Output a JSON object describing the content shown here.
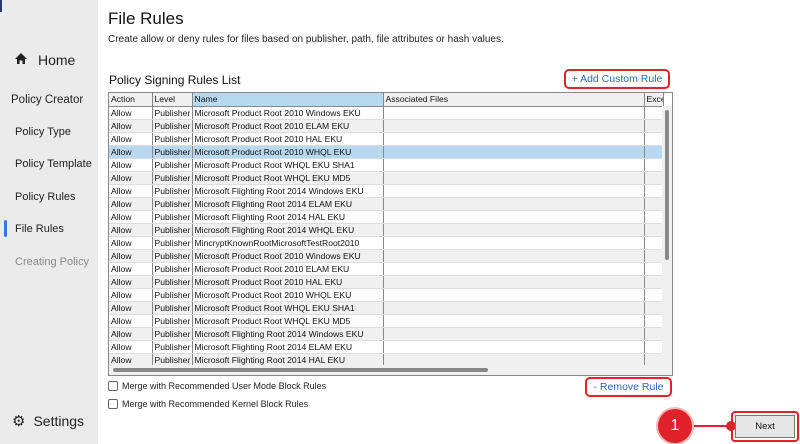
{
  "sidebar": {
    "home": "Home",
    "section": "Policy Creator",
    "items": [
      {
        "label": "Policy Type"
      },
      {
        "label": "Policy Template"
      },
      {
        "label": "Policy Rules"
      },
      {
        "label": "File Rules"
      },
      {
        "label": "Creating Policy"
      }
    ],
    "settings": "Settings"
  },
  "page": {
    "title": "File Rules",
    "description": "Create allow or deny rules for files based on publisher, path, file attributes or hash values.",
    "list_title": "Policy Signing Rules List",
    "add_button": "+ Add Custom Rule",
    "remove_button": "- Remove Rule",
    "next_button": "Next",
    "step_marker": "1"
  },
  "table": {
    "columns": [
      "Action",
      "Level",
      "Name",
      "Associated Files",
      "Exce"
    ],
    "rows": [
      [
        "Allow",
        "Publisher",
        "Microsoft Product Root 2010 Windows EKU"
      ],
      [
        "Allow",
        "Publisher",
        "Microsoft Product Root 2010 ELAM EKU"
      ],
      [
        "Allow",
        "Publisher",
        "Microsoft Product Root 2010 HAL EKU"
      ],
      [
        "Allow",
        "Publisher",
        "Microsoft Product Root 2010 WHQL EKU"
      ],
      [
        "Allow",
        "Publisher",
        "Microsoft Product Root WHQL EKU SHA1"
      ],
      [
        "Allow",
        "Publisher",
        "Microsoft Product Root WHQL EKU MD5"
      ],
      [
        "Allow",
        "Publisher",
        "Microsoft Flighting Root 2014 Windows EKU"
      ],
      [
        "Allow",
        "Publisher",
        "Microsoft Flighting Root 2014 ELAM EKU"
      ],
      [
        "Allow",
        "Publisher",
        "Microsoft Flighting Root 2014 HAL EKU"
      ],
      [
        "Allow",
        "Publisher",
        "Microsoft Flighting Root 2014 WHQL EKU"
      ],
      [
        "Allow",
        "Publisher",
        "MincryptKnownRootMicrosoftTestRoot2010"
      ],
      [
        "Allow",
        "Publisher",
        "Microsoft Product Root 2010 Windows EKU"
      ],
      [
        "Allow",
        "Publisher",
        "Microsoft Product Root 2010 ELAM EKU"
      ],
      [
        "Allow",
        "Publisher",
        "Microsoft Product Root 2010 HAL EKU"
      ],
      [
        "Allow",
        "Publisher",
        "Microsoft Product Root 2010 WHQL EKU"
      ],
      [
        "Allow",
        "Publisher",
        "Microsoft Product Root WHQL EKU SHA1"
      ],
      [
        "Allow",
        "Publisher",
        "Microsoft Product Root WHQL EKU MD5"
      ],
      [
        "Allow",
        "Publisher",
        "Microsoft Flighting Root 2014 Windows EKU"
      ],
      [
        "Allow",
        "Publisher",
        "Microsoft Flighting Root 2014 ELAM EKU"
      ],
      [
        "Allow",
        "Publisher",
        "Microsoft Flighting Root 2014 HAL EKU"
      ]
    ],
    "selected_row": 3
  },
  "options": {
    "user_mode": "Merge with Recommended User Mode Block Rules",
    "kernel": "Merge with Recommended Kernel Block Rules"
  }
}
